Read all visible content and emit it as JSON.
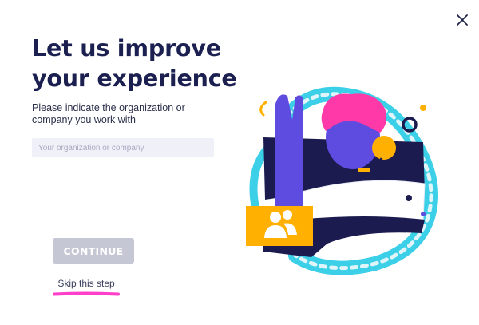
{
  "dialog": {
    "title_line1": "Let us improve",
    "title_line2": "your experience",
    "subtitle": "Please indicate the organization or company you work with",
    "org_input": {
      "value": "",
      "placeholder": "Your organization or company"
    },
    "continue_label": "CONTINUE",
    "skip_label": "Skip this step"
  },
  "colors": {
    "title": "#1b2050",
    "button_disabled": "#c5c8d4",
    "skip_highlight": "#ff3ec9",
    "navy": "#1c1b4f",
    "purple": "#5e4be0",
    "pink": "#ff3aa8",
    "orange": "#ffb000",
    "cyan": "#3ccfe8"
  },
  "icons": [
    "close-icon",
    "team-icon",
    "support-agent-illustration"
  ]
}
